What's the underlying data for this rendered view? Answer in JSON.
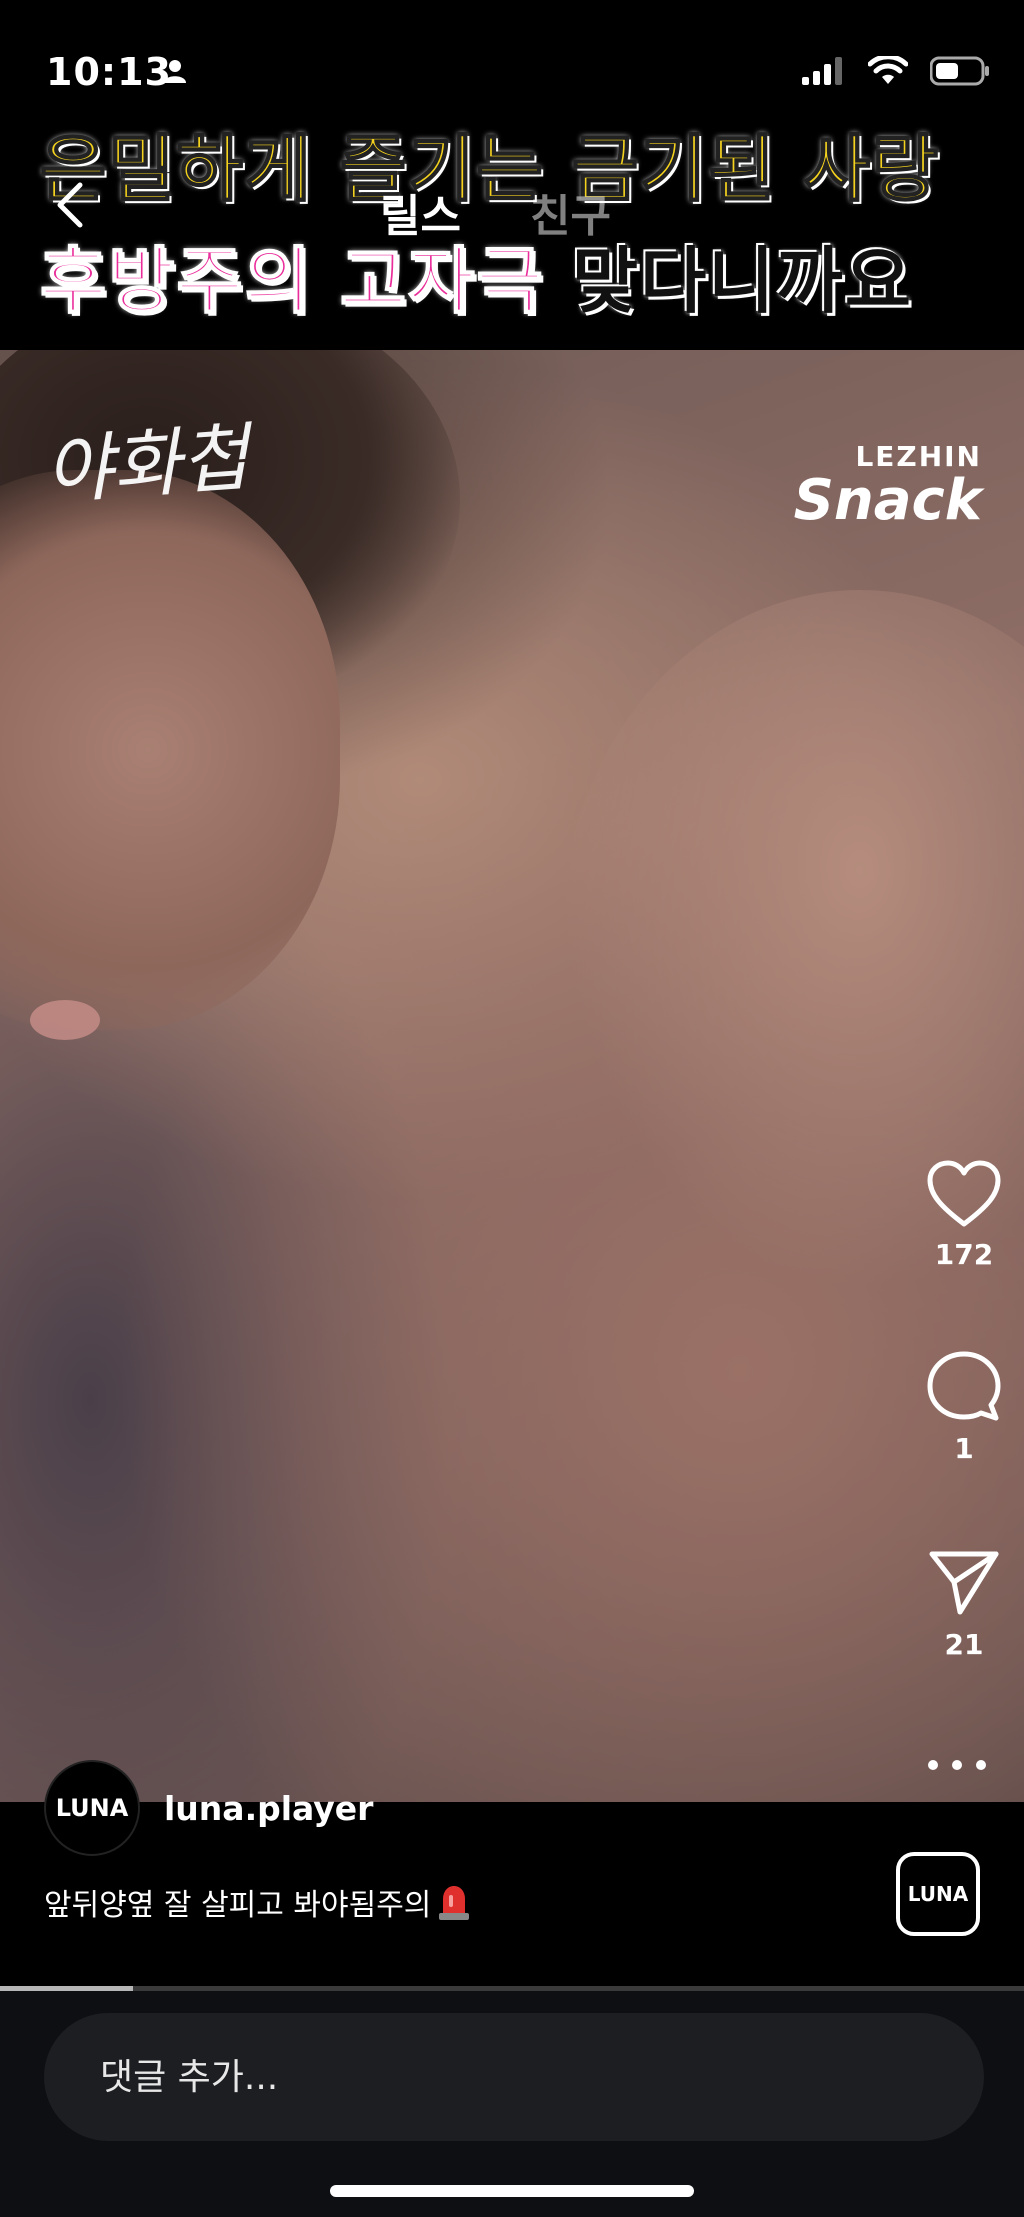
{
  "status_bar": {
    "time": "10:13"
  },
  "banner": {
    "line1": "은밀하게 즐기는 금기된 사랑",
    "line2_pink": "후방주의 고자극",
    "line2_black": "맞다니까요"
  },
  "nav": {
    "tabs": [
      {
        "label": "릴스",
        "active": true
      },
      {
        "label": "친구",
        "active": false
      }
    ]
  },
  "video": {
    "logo_left": "야화첩",
    "logo_right_top": "LEZHIN",
    "logo_right_bottom": "Snack"
  },
  "actions": {
    "likes": "172",
    "comments": "1",
    "shares": "21"
  },
  "author": {
    "avatar_text": "LUNA",
    "username": "luna.player"
  },
  "caption": {
    "text": "앞뒤양옆 잘 살피고 봐야됨주의"
  },
  "audio": {
    "label": "LUNA"
  },
  "progress": {
    "fraction": 0.13
  },
  "comment": {
    "placeholder": "댓글 추가..."
  },
  "colors": {
    "banner_yellow": "#f4d21e",
    "banner_pink": "#ea2d9a"
  }
}
